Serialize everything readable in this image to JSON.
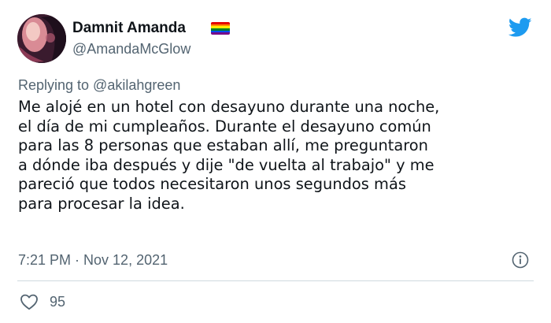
{
  "author": {
    "display_name": "Damnit Amanda",
    "handle": "@AmandaMcGlow",
    "avatar_icon": "profile-avatar",
    "flag_icon": "rainbow-flag-emoji"
  },
  "brand": {
    "icon": "twitter-bird-icon",
    "color": "#1d9bf0"
  },
  "tweet": {
    "replying_to": "Replying to @akilahgreen",
    "lines": [
      "Me alojé en un hotel con desayuno durante una noche,",
      "el día de mi cumpleaños. Durante el desayuno común",
      "para las 8 personas que estaban allí, me preguntaron",
      "a dónde iba después y dije \"de vuelta al trabajo\" y me",
      "pareció que todos necesitaron unos segundos más",
      "para procesar la idea."
    ],
    "timestamp": "7:21 PM · Nov 12, 2021",
    "info_icon": "info-icon"
  },
  "engagement": {
    "like_icon": "heart-icon",
    "likes": "95"
  },
  "colors": {
    "text": "#0f1419",
    "secondary": "#536471",
    "divider": "#cfd9de"
  }
}
